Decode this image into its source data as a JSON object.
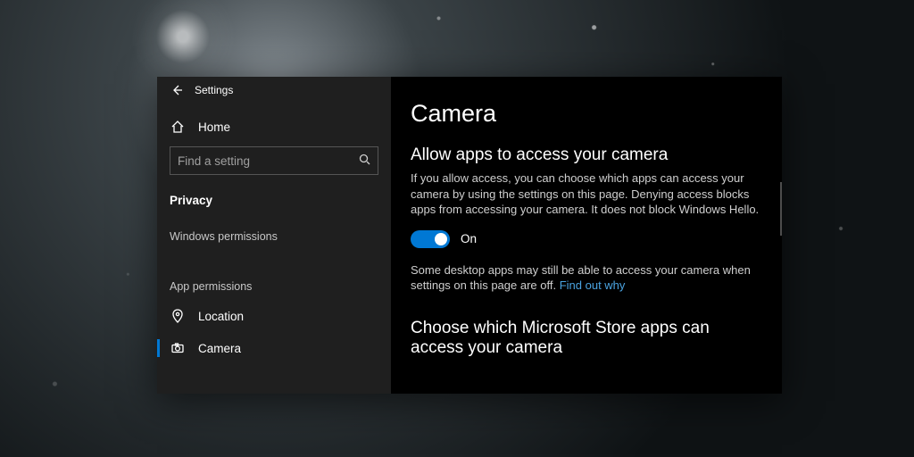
{
  "window": {
    "title": "Settings"
  },
  "sidebar": {
    "home": "Home",
    "search_placeholder": "Find a setting",
    "section_active": "Privacy",
    "group1_header": "Windows permissions",
    "group2_header": "App permissions",
    "items": {
      "location": "Location",
      "camera": "Camera"
    }
  },
  "main": {
    "page_title": "Camera",
    "section1_heading": "Allow apps to access your camera",
    "section1_body": "If you allow access, you can choose which apps can access your camera by using the settings on this page. Denying access blocks apps from accessing your camera. It does not block Windows Hello.",
    "toggle_state": "On",
    "desktop_note_a": "Some desktop apps may still be able to access your camera when settings on this page are off. ",
    "desktop_note_link": "Find out why",
    "section2_heading": "Choose which Microsoft Store apps can access your camera"
  },
  "colors": {
    "accent": "#0078d4"
  }
}
